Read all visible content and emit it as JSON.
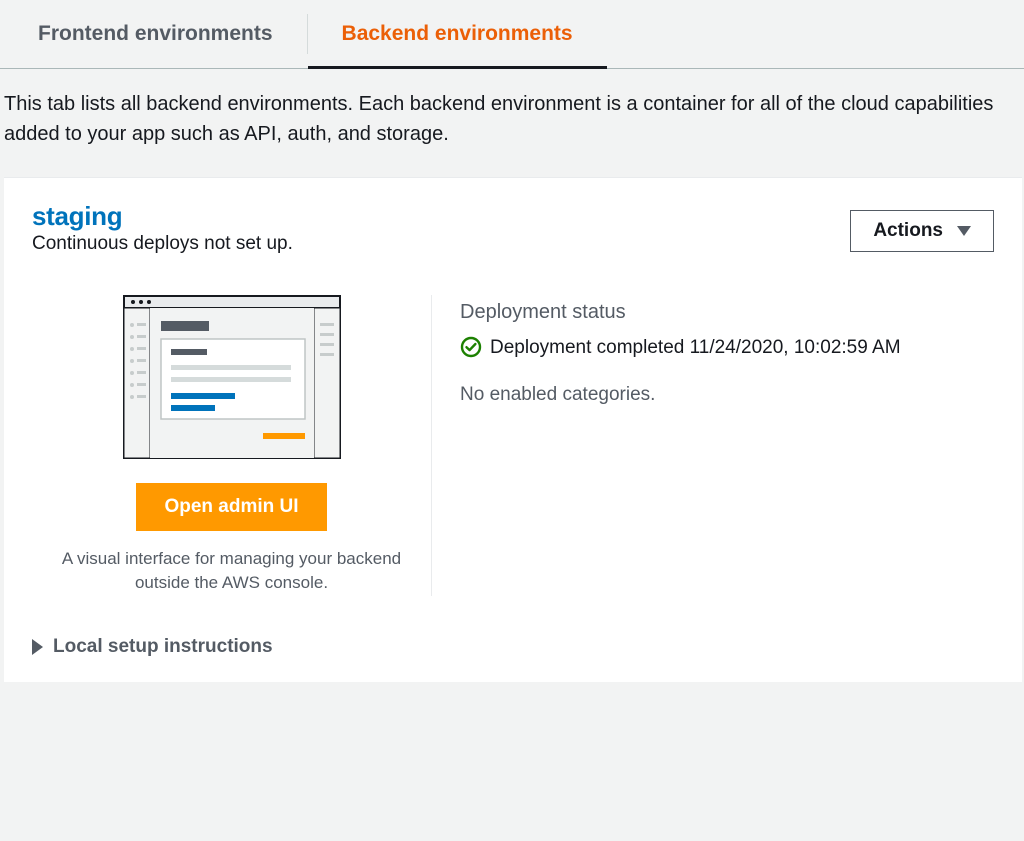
{
  "tabs": {
    "frontend": "Frontend environments",
    "backend": "Backend environments"
  },
  "description": "This tab lists all backend environments. Each backend environment is a container for all of the cloud capabilities added to your app such as API, auth, and storage.",
  "env": {
    "name": "staging",
    "subtext": "Continuous deploys not set up.",
    "actions_label": "Actions",
    "open_admin_label": "Open admin UI",
    "admin_desc": "A visual interface for managing your backend outside the AWS console.",
    "deploy_heading": "Deployment status",
    "deploy_status": "Deployment completed 11/24/2020, 10:02:59 AM",
    "categories": "No enabled categories.",
    "local_setup": "Local setup instructions"
  }
}
